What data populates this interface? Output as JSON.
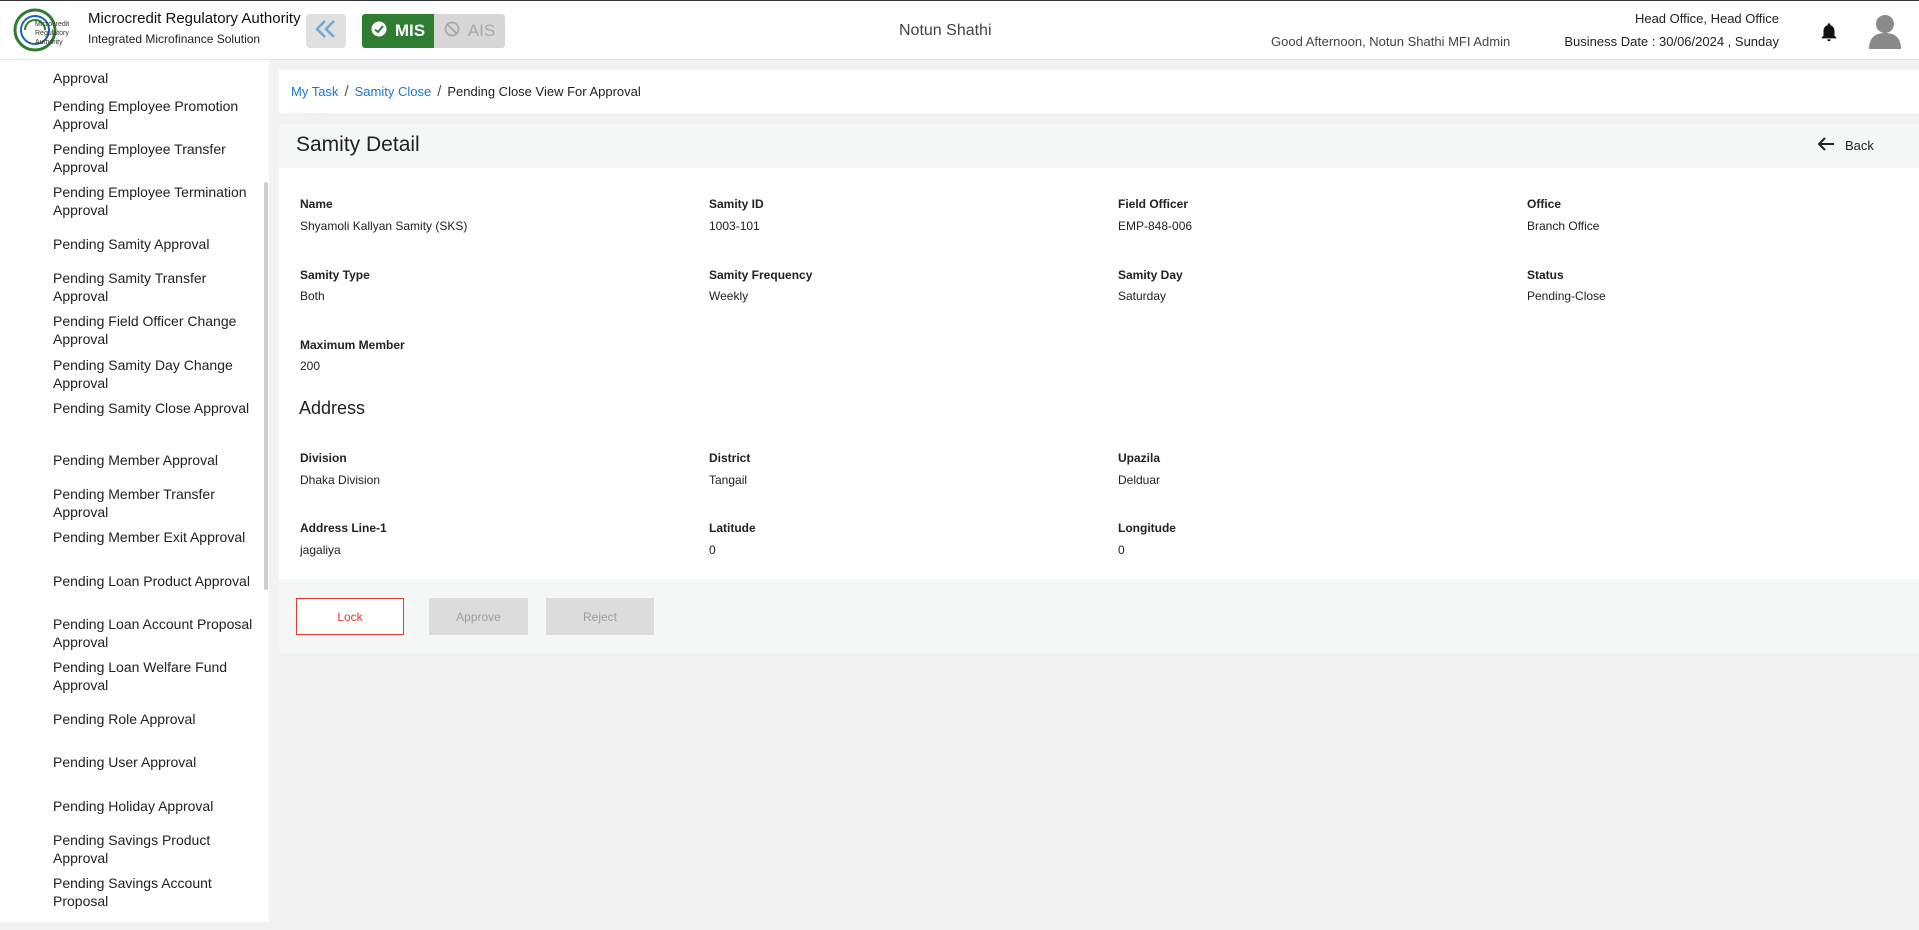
{
  "header": {
    "brand_title": "Microcredit Regulatory Authority",
    "brand_subtitle": "Integrated Microfinance Solution",
    "logo_text_1": "Microcredit",
    "logo_text_2": "Regulatory",
    "logo_text_3": "Authority",
    "mis_label": "MIS",
    "ais_label": "AIS",
    "org_name": "Notun Shathi",
    "greeting": "Good Afternoon, Notun Shathi MFI Admin",
    "office": "Head Office, Head Office",
    "business_date": "Business Date : 30/06/2024 , Sunday",
    "accent_color": "#2e7d32"
  },
  "sidebar": {
    "items": [
      {
        "label": "Approval"
      },
      {
        "label": "Pending Employee Promotion Approval"
      },
      {
        "label": "Pending Employee Transfer Approval"
      },
      {
        "label": "Pending Employee Termination Approval"
      },
      {
        "label": "Pending Samity Approval"
      },
      {
        "label": "Pending Samity Transfer Approval"
      },
      {
        "label": "Pending Field Officer Change Approval"
      },
      {
        "label": "Pending Samity Day Change Approval"
      },
      {
        "label": "Pending Samity Close Approval"
      },
      {
        "label": "Pending Member Approval"
      },
      {
        "label": "Pending Member Transfer Approval"
      },
      {
        "label": "Pending Member Exit Approval"
      },
      {
        "label": "Pending Loan Product Approval"
      },
      {
        "label": "Pending Loan Account Proposal Approval"
      },
      {
        "label": "Pending Loan Welfare Fund Approval"
      },
      {
        "label": "Pending Role Approval"
      },
      {
        "label": "Pending User Approval"
      },
      {
        "label": "Pending Holiday Approval"
      },
      {
        "label": "Pending Savings Product Approval"
      },
      {
        "label": "Pending Savings Account Proposal"
      }
    ]
  },
  "breadcrumb": {
    "items": [
      "My Task",
      "Samity Close"
    ],
    "separator": "/",
    "current": "Pending Close View For Approval"
  },
  "detail": {
    "title": "Samity Detail",
    "back_label": "Back",
    "fields": [
      {
        "label": "Name",
        "value": "Shyamoli Kallyan Samity (SKS)"
      },
      {
        "label": "Samity ID",
        "value": "1003-101"
      },
      {
        "label": "Field Officer",
        "value": "EMP-848-006"
      },
      {
        "label": "Office",
        "value": "Branch Office"
      },
      {
        "label": "Samity Type",
        "value": "Both"
      },
      {
        "label": "Samity Frequency",
        "value": "Weekly"
      },
      {
        "label": "Samity Day",
        "value": "Saturday"
      },
      {
        "label": "Status",
        "value": "Pending-Close"
      },
      {
        "label": "Maximum Member",
        "value": "200"
      }
    ],
    "address_title": "Address",
    "address_fields": [
      {
        "label": "Division",
        "value": "Dhaka Division"
      },
      {
        "label": "District",
        "value": "Tangail"
      },
      {
        "label": "Upazila",
        "value": "Delduar"
      },
      {
        "label": "Address Line-1",
        "value": "jagaliya"
      },
      {
        "label": "Latitude",
        "value": "0"
      },
      {
        "label": "Longitude",
        "value": "0"
      }
    ]
  },
  "actions": {
    "lock_label": "Lock",
    "approve_label": "Approve",
    "reject_label": "Reject"
  }
}
